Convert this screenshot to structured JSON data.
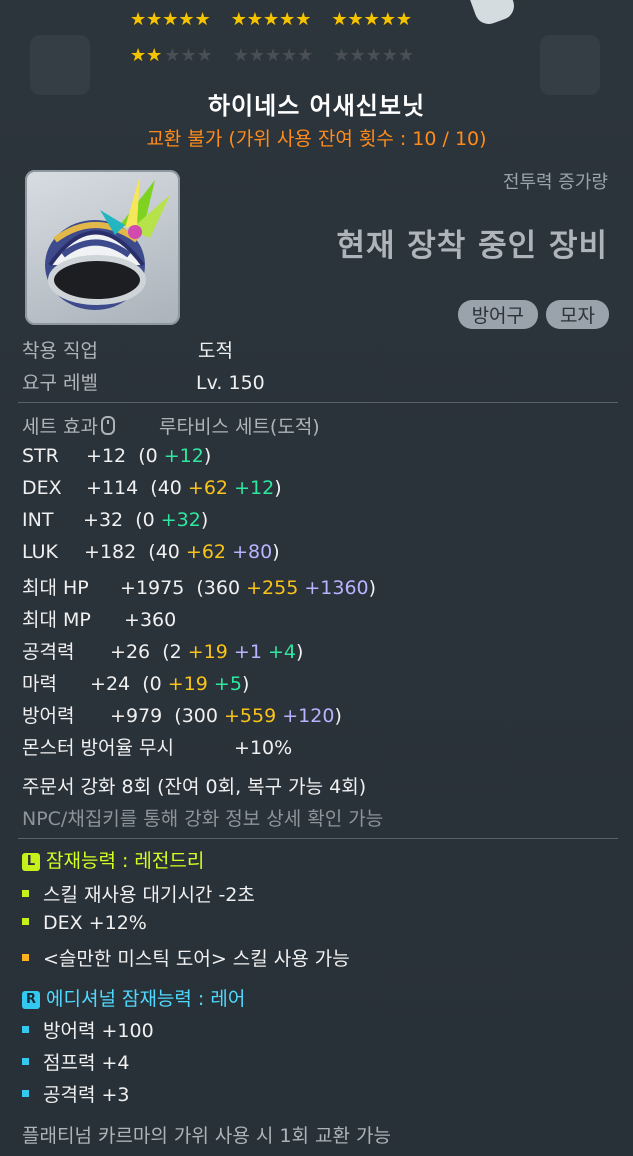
{
  "stars": {
    "row1": {
      "on": 15,
      "off": 0
    },
    "row2": {
      "on": 2,
      "off": 13
    },
    "total": 30,
    "filled": 17
  },
  "item": {
    "name": "하이네스 어새신보닛",
    "trade_note": "교환 불가 (가위 사용 잔여 횟수 : 10 / 10)",
    "power_label": "전투력 증가량",
    "equipped_label": "현재 장착 중인 장비",
    "tags": [
      "방어구",
      "모자"
    ],
    "icon": "helmet-icon"
  },
  "requirements": {
    "job_label": "착용 직업",
    "job_value": "도적",
    "level_label": "요구 레벨",
    "level_value": "Lv. 150"
  },
  "set": {
    "label": "세트 효과",
    "icon": "mouse-icon",
    "value": "루타비스 세트(도적)"
  },
  "stats": {
    "str": {
      "label": "STR",
      "total": "+12",
      "base": "(0",
      "add1": "+12",
      "close": ")"
    },
    "dex": {
      "label": "DEX",
      "total": "+114",
      "base": "(40",
      "add1": "+62",
      "add2": "+12",
      "close": ")"
    },
    "int": {
      "label": "INT",
      "total": "+32",
      "base": "(0",
      "add1": "+32",
      "close": ")"
    },
    "luk": {
      "label": "LUK",
      "total": "+182",
      "base": "(40",
      "add1": "+62",
      "add2": "+80",
      "close": ")"
    },
    "hp": {
      "label": "최대 HP",
      "total": "+1975",
      "base": "(360",
      "add1": "+255",
      "add2": "+1360",
      "close": ")"
    },
    "mp": {
      "label": "최대 MP",
      "total": "+360"
    },
    "att": {
      "label": "공격력",
      "total": "+26",
      "base": "(2",
      "add1": "+19",
      "add2": "+1",
      "add3": "+4",
      "close": ")"
    },
    "matt": {
      "label": "마력",
      "total": "+24",
      "base": "(0",
      "add1": "+19",
      "add2": "+5",
      "close": ")"
    },
    "def": {
      "label": "방어력",
      "total": "+979",
      "base": "(300",
      "add1": "+559",
      "add2": "+120",
      "close": ")"
    },
    "ignore": {
      "label": "몬스터 방어율 무시",
      "total": "+10%"
    }
  },
  "enhance": {
    "scroll": "주문서 강화 8회 (잔여 0회, 복구 가능 4회)",
    "npc_note": "NPC/채집키를 통해 강화 정보 상세 확인 가능"
  },
  "potential": {
    "badge": "L",
    "title": "잠재능력 : 레전드리",
    "lines": [
      "스킬 재사용 대기시간 -2초",
      "DEX +12%",
      "<슬만한 미스틱 도어> 스킬 사용 가능"
    ]
  },
  "additional": {
    "badge": "R",
    "title": "에디셔널 잠재능력 : 레어",
    "lines": [
      "방어력 +100",
      "점프력 +4",
      "공격력 +3"
    ]
  },
  "footer": "플래티넘 카르마의 가위 사용 시 1회 교환 가능",
  "colors": {
    "base_bonus": "#f9c31a",
    "scroll_bonus": "#2ee7a0",
    "flame_bonus": "#b9b4ff",
    "legendary": "#c8f01b",
    "rare": "#33c8f0",
    "trade_warning": "#ff8c1a"
  }
}
